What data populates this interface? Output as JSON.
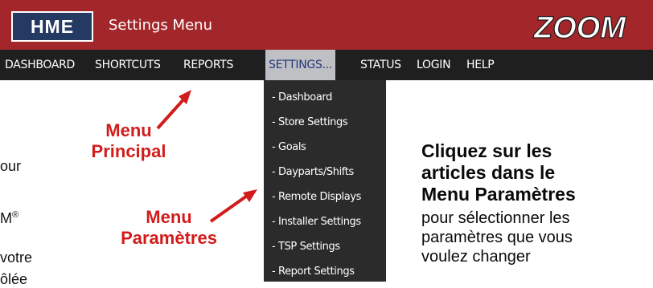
{
  "header": {
    "brand": "HME",
    "title": "Settings Menu",
    "logo_text": "ZOOM"
  },
  "nav": {
    "items": [
      {
        "label": "DASHBOARD"
      },
      {
        "label": "SHORTCUTS"
      },
      {
        "label": "REPORTS"
      },
      {
        "label": "SETTINGS..."
      },
      {
        "label": "STATUS"
      },
      {
        "label": "LOGIN"
      },
      {
        "label": "HELP"
      }
    ],
    "active_index": 3
  },
  "dropdown": {
    "items": [
      {
        "label": "- Dashboard"
      },
      {
        "label": "- Store Settings"
      },
      {
        "label": "- Goals"
      },
      {
        "label": "- Dayparts/Shifts"
      },
      {
        "label": "- Remote Displays"
      },
      {
        "label": "- Installer Settings"
      },
      {
        "label": "- TSP Settings"
      },
      {
        "label": "- Report Settings"
      }
    ]
  },
  "callouts": {
    "main_menu": {
      "line1": "Menu",
      "line2": "Principal"
    },
    "settings_menu": {
      "line1": "Menu",
      "line2": "Paramètres"
    }
  },
  "left_fragments": {
    "line1": "our",
    "line2": "M",
    "line2_sup": "®",
    "line3": "votre",
    "line4": "ôlée"
  },
  "instructions": {
    "bold_lines": [
      "Cliquez sur les",
      "articles dans le",
      "Menu Paramètres"
    ],
    "normal_lines": [
      "pour sélectionner les",
      "paramètres que vous",
      "voulez changer"
    ]
  },
  "colors": {
    "header_red": "#a3262a",
    "nav_black": "#1f1f1f",
    "active_tab": "#bfc0c4",
    "brand_blue": "#243a63",
    "callout_red": "#d21c1c"
  }
}
